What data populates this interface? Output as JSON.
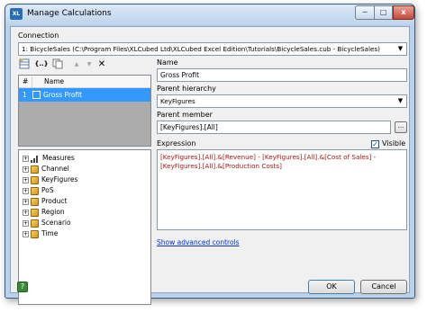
{
  "window": {
    "title": "Manage Calculations",
    "app_icon_text": "XL",
    "controls": {
      "minimize": "─",
      "maximize": "□",
      "close": "x"
    }
  },
  "connection": {
    "label": "Connection",
    "value": "1: BicycleSales (C:\\Program Files\\XLCubed Ltd\\XLCubed Excel Edition\\Tutorials\\BicycleSales.cub - BicycleSales)"
  },
  "toolbar": {
    "icons": [
      "new-calculation-icon",
      "insert-brackets-icon",
      "copy-icon",
      "move-up-icon",
      "move-down-icon",
      "delete-icon"
    ],
    "brackets_glyph": "{..}",
    "up_glyph": "▲",
    "down_glyph": "▼",
    "delete_glyph": "✕"
  },
  "calc_list": {
    "columns": [
      "#",
      "Name"
    ],
    "rows": [
      {
        "num": "1",
        "name": "Gross Profit",
        "selected": true
      }
    ]
  },
  "tree": {
    "items": [
      "Measures",
      "Channel",
      "KeyFigures",
      "PoS",
      "Product",
      "Region",
      "Scenario",
      "Time"
    ]
  },
  "form": {
    "name_label": "Name",
    "name_value": "Gross Profit",
    "parent_hierarchy_label": "Parent hierarchy",
    "parent_hierarchy_value": "KeyFigures",
    "parent_member_label": "Parent member",
    "parent_member_value": "[KeyFigures].[All]",
    "browse_label": "...",
    "expression_label": "Expression",
    "visible_label": "Visible",
    "visible_checked": true,
    "expression_value": "[KeyFigures].[All].&[Revenue] - [KeyFigures].[All].&[Cost of Sales] - [KeyFigures].[All].&[Production Costs]",
    "advanced_link": "Show advanced controls"
  },
  "buttons": {
    "ok": "OK",
    "cancel": "Cancel",
    "help": "?"
  },
  "colors": {
    "selection": "#3399ff",
    "expression_text": "#a31515",
    "link": "#0033cc",
    "frame": "#b9d1ea"
  }
}
